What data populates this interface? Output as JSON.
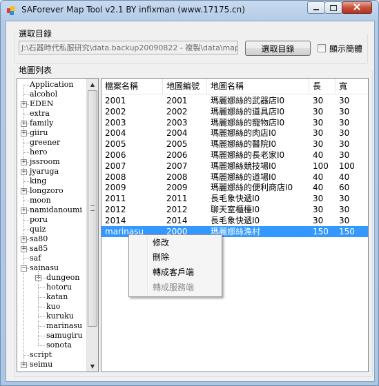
{
  "window": {
    "title": "SAForever Map Tool v2.1 BY infixman (www.17175.cn)"
  },
  "folder": {
    "group_label": "選取目錄",
    "path": "J:\\石器時代私服研究\\data.backup20090822 - 複製\\data\\map",
    "browse_button": "選取目錄",
    "show_simplified_label": "顯示簡體",
    "show_simplified_checked": false
  },
  "maplist_label": "地圖列表",
  "tree": {
    "nodes": [
      {
        "label": "Application",
        "expandable": false
      },
      {
        "label": "alcohol",
        "expandable": false
      },
      {
        "label": "EDEN",
        "expandable": true
      },
      {
        "label": "extra",
        "expandable": false
      },
      {
        "label": "family",
        "expandable": true
      },
      {
        "label": "giiru",
        "expandable": true
      },
      {
        "label": "greener",
        "expandable": false
      },
      {
        "label": "hero",
        "expandable": false
      },
      {
        "label": "jssroom",
        "expandable": true
      },
      {
        "label": "jyaruga",
        "expandable": true
      },
      {
        "label": "king",
        "expandable": false
      },
      {
        "label": "longzoro",
        "expandable": true
      },
      {
        "label": "moon",
        "expandable": false
      },
      {
        "label": "namidanoumi",
        "expandable": true
      },
      {
        "label": "poru",
        "expandable": false
      },
      {
        "label": "quiz",
        "expandable": false
      },
      {
        "label": "sa80",
        "expandable": true
      },
      {
        "label": "sa85",
        "expandable": true
      },
      {
        "label": "saf",
        "expandable": false
      },
      {
        "label": "sainasu",
        "expandable": true,
        "expanded": true,
        "expander": "-",
        "children": [
          {
            "label": "dungeon",
            "expandable": true
          },
          {
            "label": "hotoru"
          },
          {
            "label": "katan"
          },
          {
            "label": "kuo"
          },
          {
            "label": "kuruku"
          },
          {
            "label": "marinasu"
          },
          {
            "label": "samugiru"
          },
          {
            "label": "sonota"
          }
        ]
      },
      {
        "label": "script",
        "expandable": false
      },
      {
        "label": "seimu",
        "expandable": true
      }
    ]
  },
  "table": {
    "columns": [
      "檔案名稱",
      "地圖編號",
      "地圖名稱",
      "長",
      "寬"
    ],
    "rows": [
      [
        "2001",
        "2001",
        "瑪麗娜絲的武器店I0",
        "30",
        "30"
      ],
      [
        "2002",
        "2002",
        "瑪麗娜絲的道具店I0",
        "30",
        "30"
      ],
      [
        "2003",
        "2003",
        "瑪麗娜絲的寵物店I0",
        "30",
        "30"
      ],
      [
        "2004",
        "2004",
        "瑪麗娜絲的肉店I0",
        "30",
        "30"
      ],
      [
        "2005",
        "2005",
        "瑪麗娜絲的醫院I0",
        "30",
        "30"
      ],
      [
        "2006",
        "2006",
        "瑪麗娜絲的長老家I0",
        "40",
        "30"
      ],
      [
        "2007",
        "2007",
        "瑪麗娜絲競技場I0",
        "100",
        "100"
      ],
      [
        "2008",
        "2008",
        "瑪麗娜絲的道場I0",
        "40",
        "40"
      ],
      [
        "2009",
        "2009",
        "瑪麗娜絲的便利商店I0",
        "40",
        "60"
      ],
      [
        "2011",
        "2011",
        "長毛象快遞I0",
        "30",
        "30"
      ],
      [
        "2012",
        "2012",
        "聊天室櫃檯I0",
        "30",
        "30"
      ],
      [
        "2014",
        "2014",
        "長毛象快遞I0",
        "30",
        "30"
      ],
      [
        "marinasu",
        "2000",
        "瑪麗娜絲漁村",
        "150",
        "150"
      ]
    ],
    "selected_row": 12
  },
  "context_menu": {
    "items": [
      {
        "label": "修改",
        "enabled": true
      },
      {
        "label": "刪除",
        "enabled": true
      },
      {
        "label": "轉成客戶端",
        "enabled": true
      },
      {
        "label": "轉成服務端",
        "enabled": false
      }
    ]
  },
  "colors": {
    "selection": "#3399ff",
    "disabled_text": "#8d8d8d"
  }
}
